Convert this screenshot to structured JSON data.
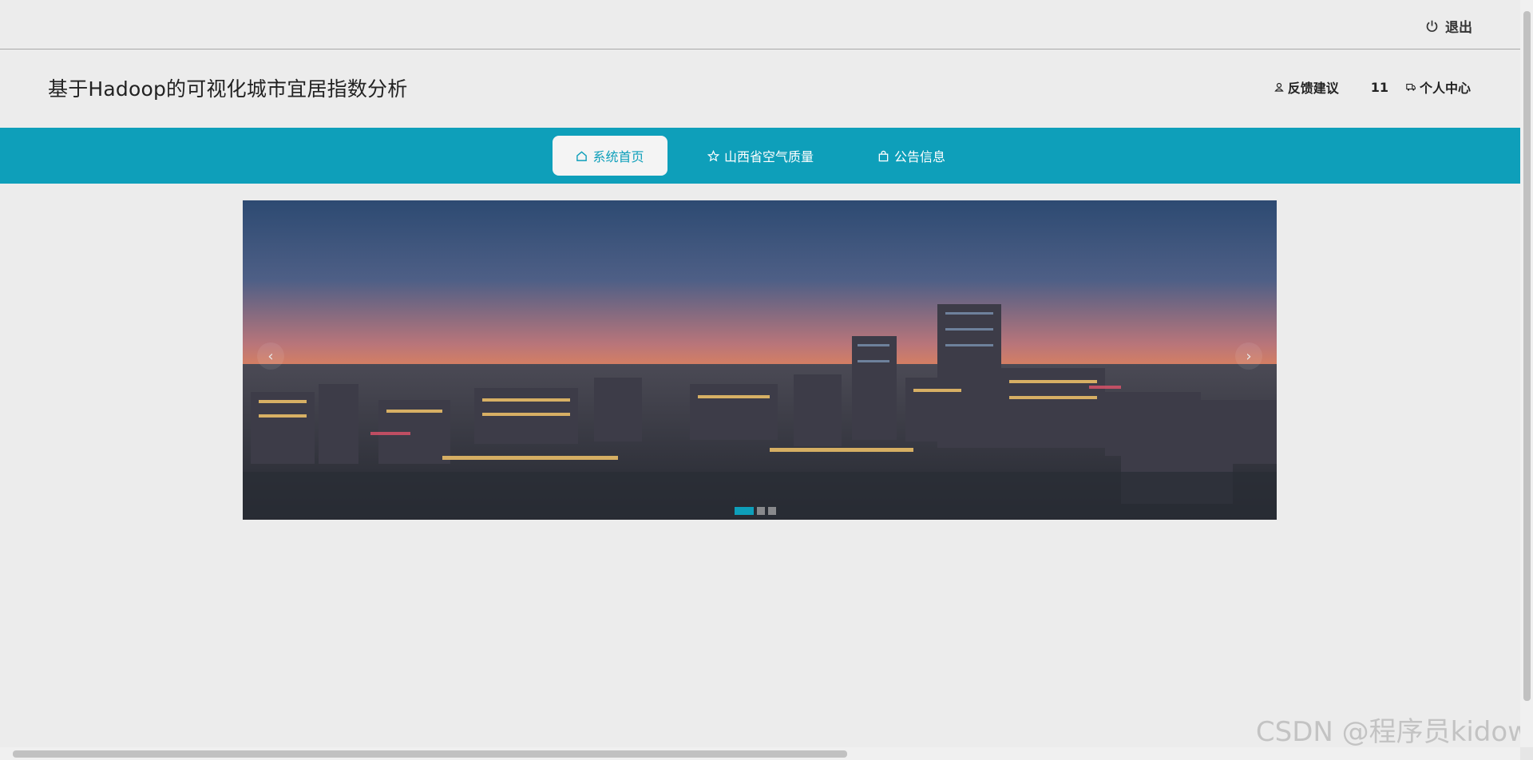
{
  "topbar": {
    "logout_label": "退出"
  },
  "header": {
    "title": "基于Hadoop的可视化城市宜居指数分析",
    "feedback_label": "反馈建议",
    "count": "11",
    "profile_label": "个人中心"
  },
  "nav": {
    "items": [
      {
        "label": "系统首页",
        "icon": "home-icon",
        "active": true
      },
      {
        "label": "山西省空气质量",
        "icon": "star-icon",
        "active": false
      },
      {
        "label": "公告信息",
        "icon": "bag-icon",
        "active": false
      }
    ]
  },
  "carousel": {
    "prev_label": "‹",
    "next_label": "›",
    "slide_count": 3,
    "active_slide": 1
  },
  "watermark": "CSDN @程序员kidow",
  "colors": {
    "accent": "#0e9fba",
    "background": "#ececec"
  }
}
